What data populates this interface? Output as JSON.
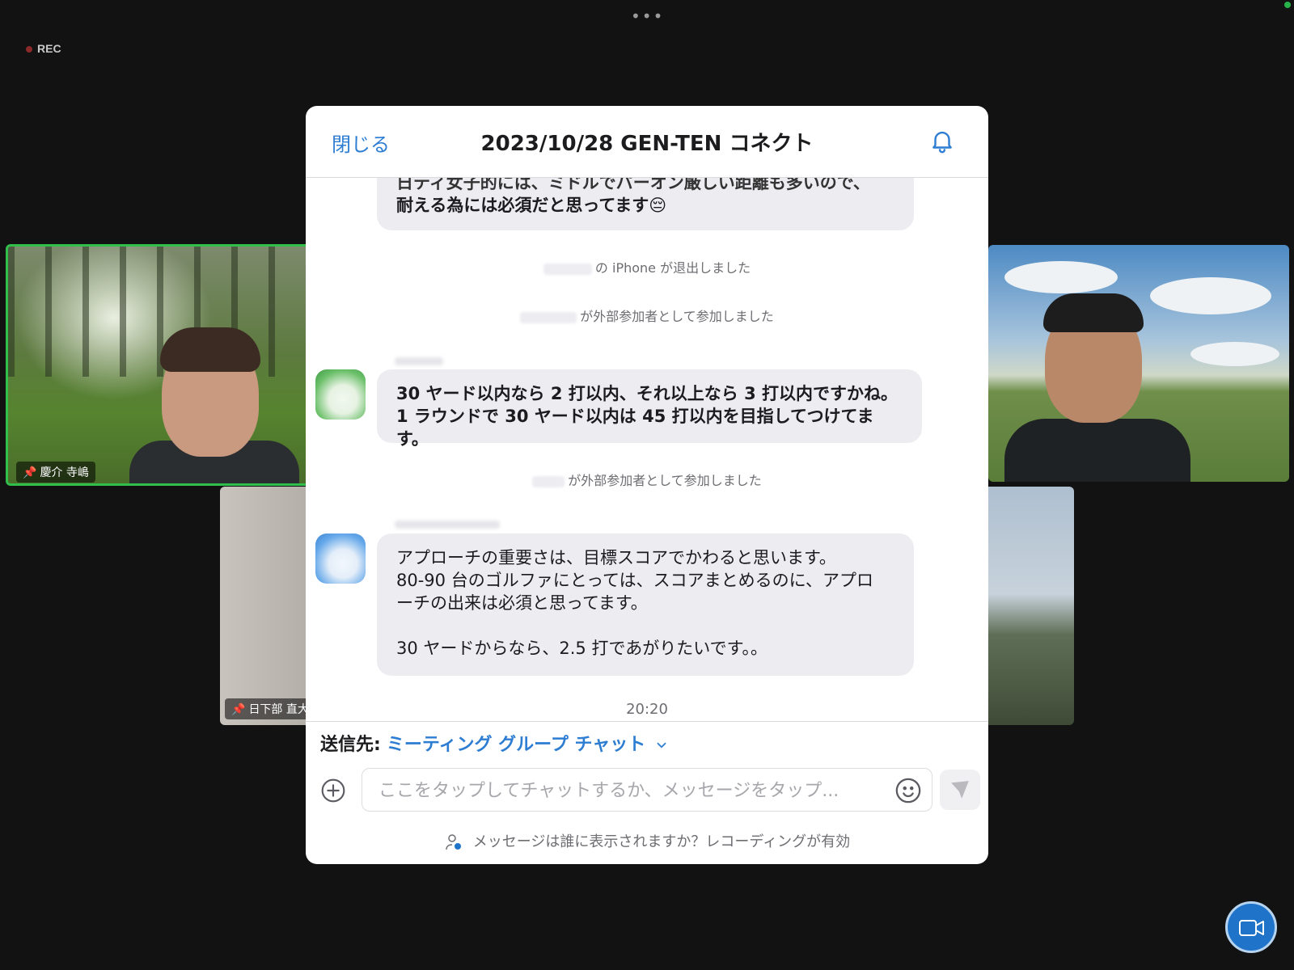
{
  "topbar": {
    "more": "•••",
    "recording": "REC"
  },
  "videos": {
    "tile1": {
      "name": "慶介 寺嶋"
    },
    "tile3": {
      "name": "日下部 直大"
    }
  },
  "chat": {
    "close": "閉じる",
    "title": "2023/10/28 GEN-TEN コネクト",
    "messages": [
      {
        "lines": [
          "日ティ女子的には、ミドルでパーオン厳しい距離も多いので、",
          "耐える為には必須だと思ってます😔"
        ]
      },
      {
        "lines": [
          "30 ヤード以内なら 2 打以内、それ以上なら 3 打以内ですかね。",
          "1 ラウンドで 30 ヤード以内は 45 打以内を目指してつけてます。"
        ]
      },
      {
        "lines": [
          "アプローチの重要さは、目標スコアでかわると思います。",
          "80-90 台のゴルファにとっては、スコアまとめるのに、アプロ",
          "ーチの出来は必須と思ってます。",
          "30 ヤードからなら、2.5 打であがりたいです。。"
        ]
      }
    ],
    "system": [
      "の iPhone が退出しました",
      "が外部参加者として参加しました",
      "が外部参加者として参加しました"
    ],
    "timestamp": "20:20",
    "to_label": "送信先:",
    "to_value": "ミーティング グループ チャット",
    "placeholder": "ここをタップしてチャットするか、メッセージをタップ...",
    "privacy": "メッセージは誰に表示されますか？レコーディングが有効"
  },
  "colors": {
    "accent": "#2d7dd2",
    "active_speaker": "#2fbf4a",
    "camera_button": "#1f73c8"
  },
  "icons": [
    "bell-icon",
    "plus-icon",
    "emoji-icon",
    "send-icon",
    "chevron-down-icon",
    "person-info-icon",
    "camera-icon",
    "pin-icon"
  ]
}
